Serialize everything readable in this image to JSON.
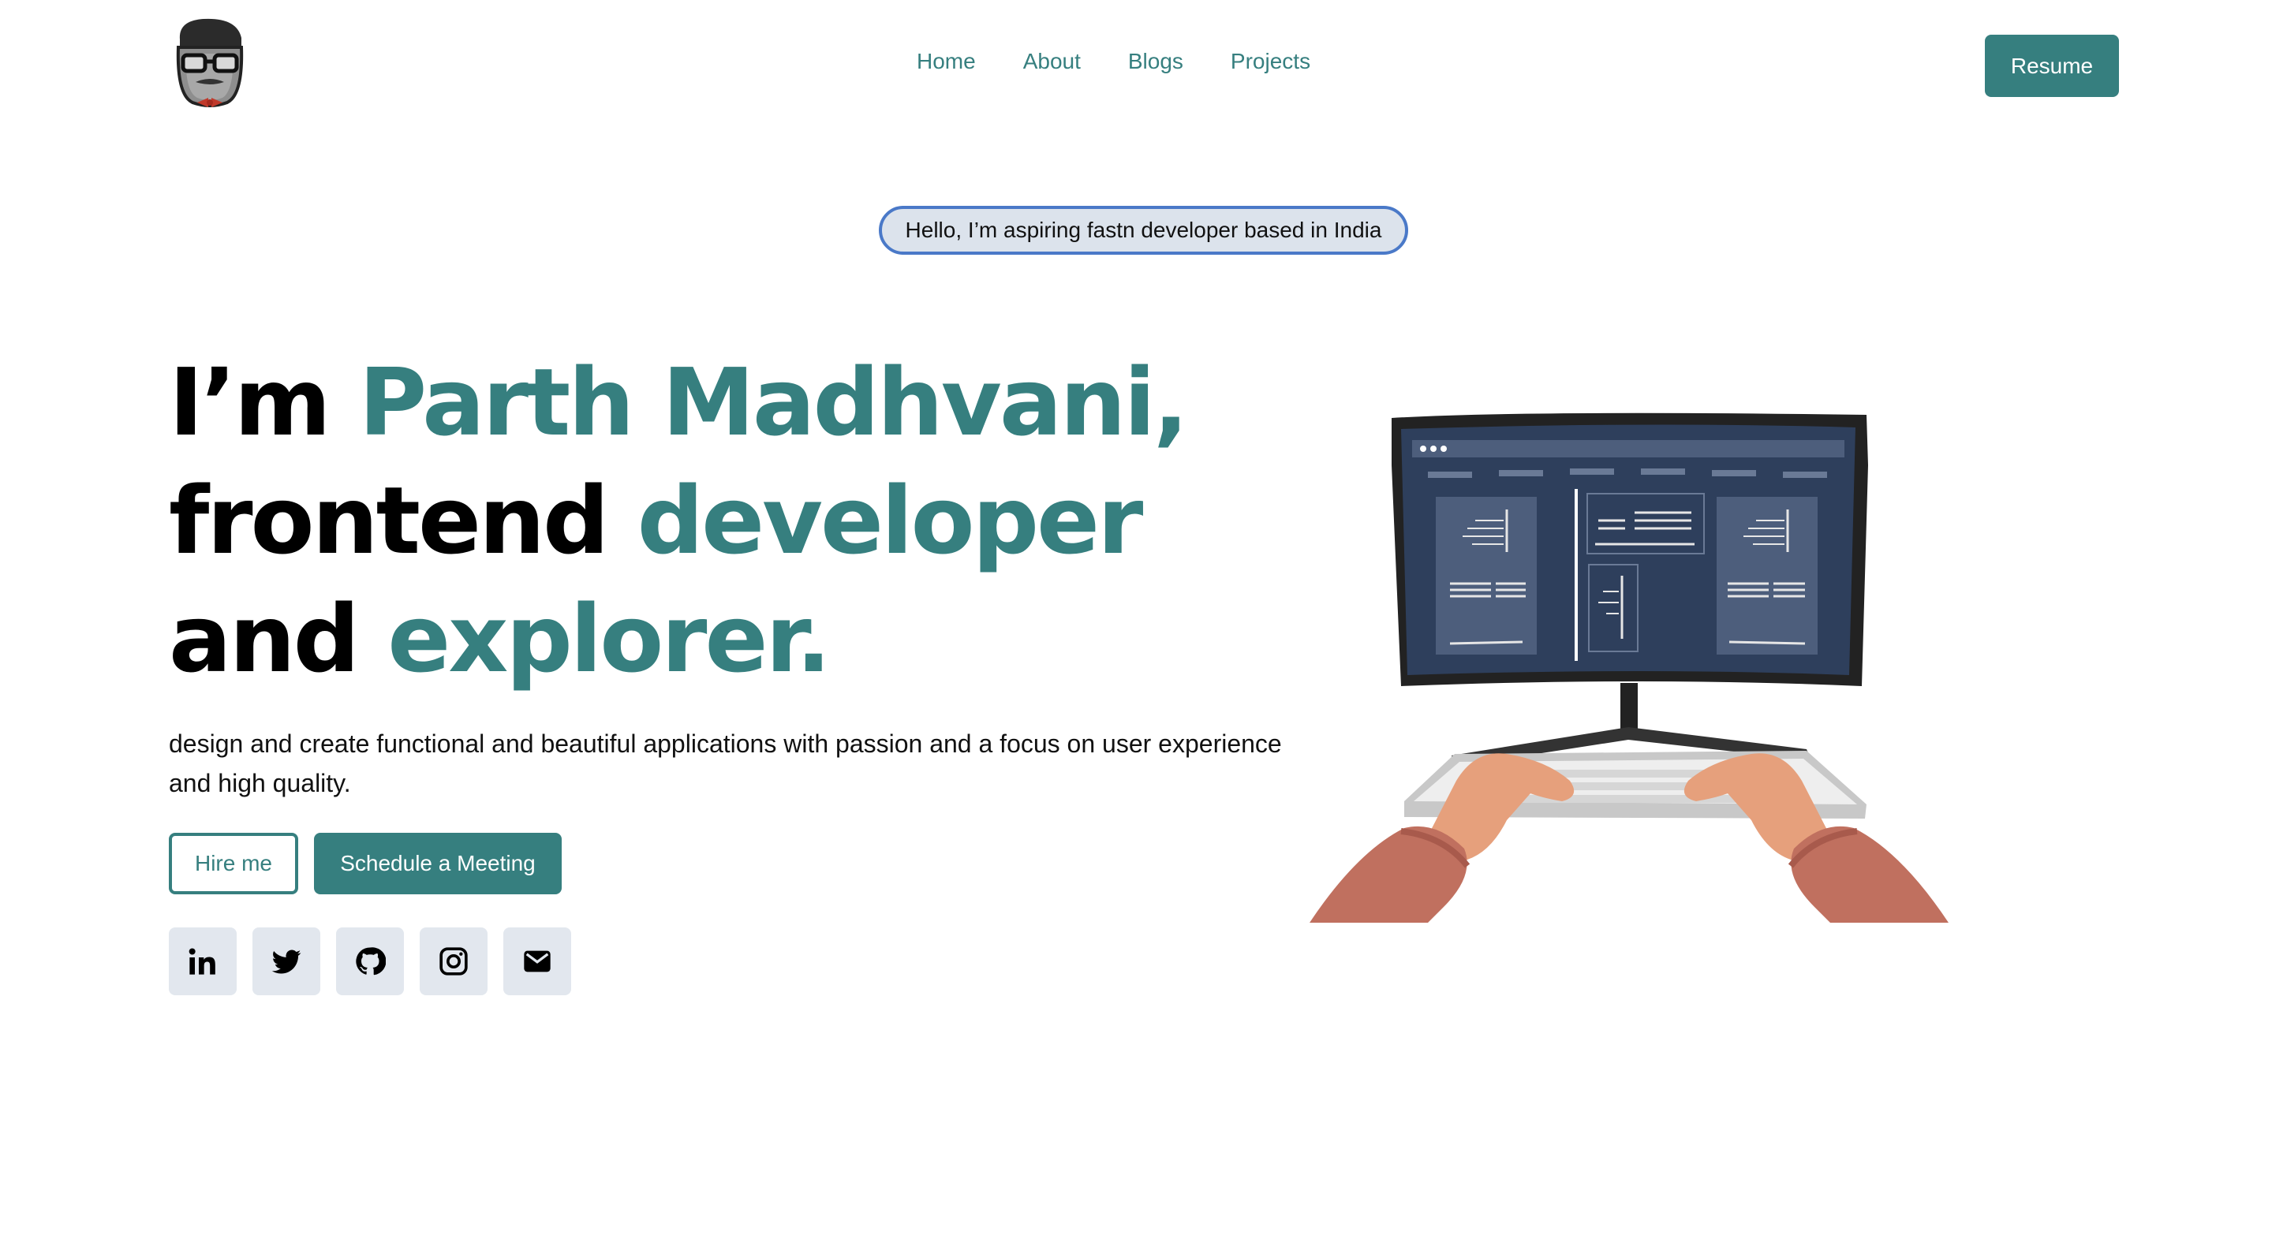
{
  "header": {
    "logo_icon": "avatar-logo-icon",
    "nav": [
      "Home",
      "About",
      "Blogs",
      "Projects"
    ],
    "resume_label": "Resume"
  },
  "hero": {
    "badge": "Hello, I’m aspiring fastn developer based in India",
    "line1_plain": "I’m ",
    "line1_accent": "Parth Madhvani,",
    "line2_plain": "frontend ",
    "line2_accent": "developer",
    "line3_plain": "and ",
    "line3_accent": "explorer.",
    "description": "design and create functional and beautiful applications with passion and a focus on user experience and high quality.",
    "hire_label": "Hire me",
    "schedule_label": "Schedule a Meeting"
  },
  "social": [
    "linkedin-icon",
    "twitter-icon",
    "github-icon",
    "instagram-icon",
    "mail-icon"
  ],
  "colors": {
    "accent": "#367f7f",
    "badge_border": "#4a79c8",
    "badge_bg": "#dce3ec",
    "social_bg": "#e2e7ee"
  }
}
